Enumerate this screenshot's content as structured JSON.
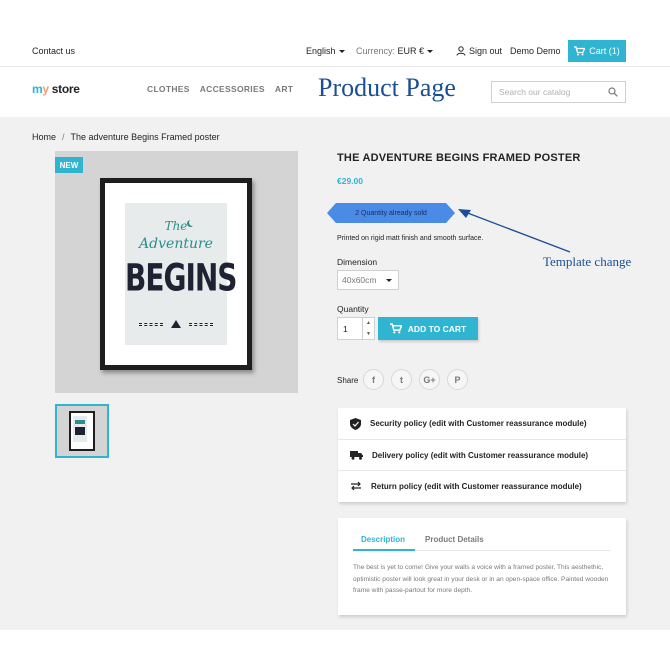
{
  "topbar": {
    "contact": "Contact us",
    "language": "English",
    "currency_label": "Currency:",
    "currency_value": "EUR €",
    "signin": "Sign out",
    "user": "Demo Demo",
    "cart": "Cart (1)"
  },
  "header": {
    "logo": {
      "part1": "m",
      "part2": "y",
      "part3": " store"
    },
    "menu": [
      "CLOTHES",
      "ACCESSORIES",
      "ART"
    ],
    "overlay_title": "Product Page",
    "search_placeholder": "Search our catalog"
  },
  "breadcrumb": {
    "home": "Home",
    "sep": "/",
    "current": "The adventure Begins Framed poster"
  },
  "product": {
    "flag": "NEW",
    "poster": {
      "line1": "The",
      "line2": "Adventure",
      "line3": "BEGINS"
    },
    "title": "THE ADVENTURE BEGINS FRAMED POSTER",
    "price": "€29.00",
    "sold_badge": "2 Quantity already sold",
    "annotation": "Template change",
    "short_desc": "Printed on rigid matt finish and smooth surface.",
    "dimension_label": "Dimension",
    "dimension_value": "40x60cm",
    "quantity_label": "Quantity",
    "quantity_value": "1",
    "add_to_cart": "ADD TO CART",
    "share_label": "Share",
    "social": [
      "f",
      "t",
      "G+",
      "P"
    ]
  },
  "reassurance": [
    {
      "icon": "shield-icon",
      "label": "Security policy (edit with Customer reassurance module)"
    },
    {
      "icon": "truck-icon",
      "label": "Delivery policy (edit with Customer reassurance module)"
    },
    {
      "icon": "swap-arrows-icon",
      "label": "Return policy (edit with Customer reassurance module)"
    }
  ],
  "tabs": {
    "items": [
      "Description",
      "Product Details"
    ],
    "description": "The best is yet to come! Give your walls a voice with a framed poster. This aesthethic, optimistic poster will look great in your desk or in an open-space office. Painted wooden frame with passe-partout for more depth."
  },
  "colors": {
    "accent": "#2fb5d2",
    "annotation": "#1a4f96",
    "badge": "#4a8be6"
  }
}
